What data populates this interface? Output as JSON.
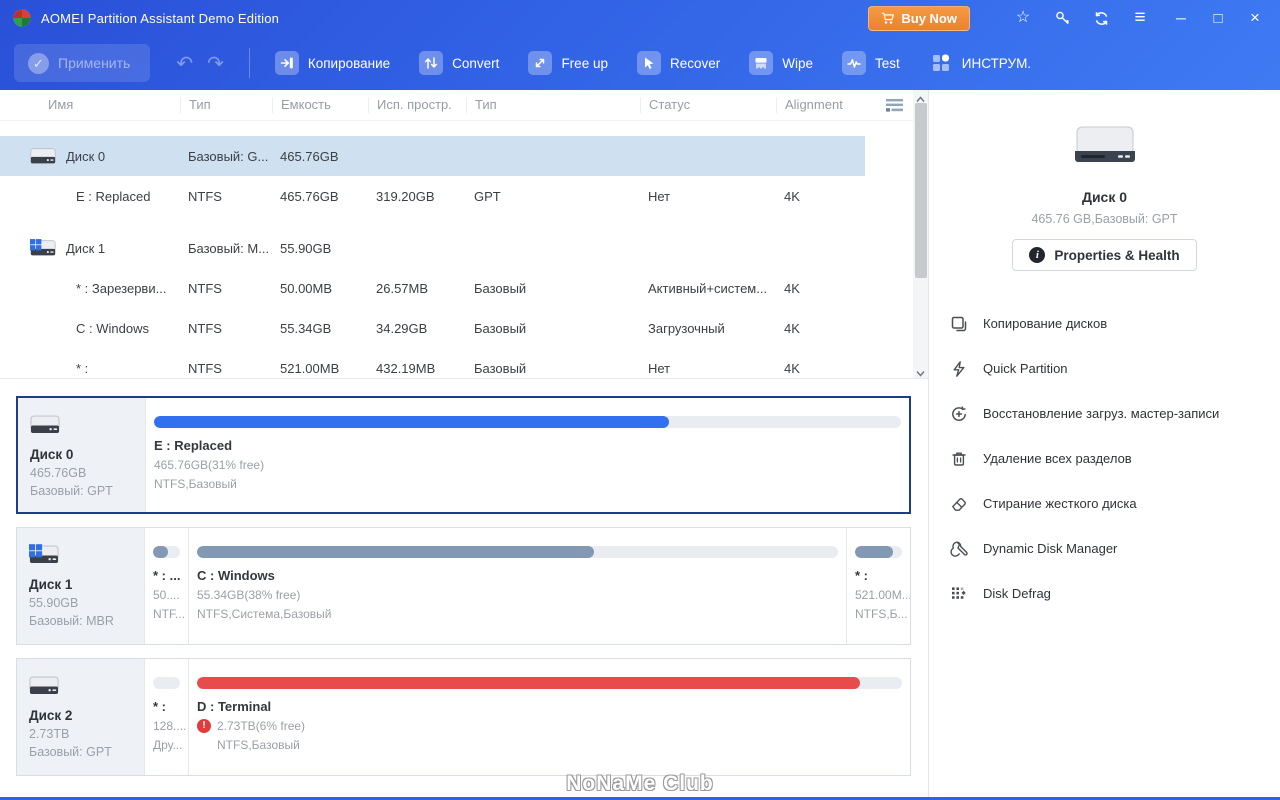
{
  "titlebar": {
    "title": "AOMEI Partition Assistant Demo Edition",
    "buy_now": "Buy Now"
  },
  "toolbar": {
    "apply": "Применить",
    "copy": "Копирование",
    "convert": "Convert",
    "freeup": "Free up",
    "recover": "Recover",
    "wipe": "Wipe",
    "test": "Test",
    "instrum": "ИНСТРУМ."
  },
  "table": {
    "columns": [
      "Имя",
      "Тип",
      "Емкость",
      "Исп. простр.",
      "Тип",
      "Статус",
      "Alignment"
    ],
    "rows": [
      {
        "name": "Диск 0",
        "type": "Базовый: G...",
        "capacity": "465.76GB",
        "used": "",
        "type2": "",
        "status": "",
        "alignment": ""
      },
      {
        "name": "E : Replaced",
        "type": "NTFS",
        "capacity": "465.76GB",
        "used": "319.20GB",
        "type2": "GPT",
        "status": "Нет",
        "alignment": "4K"
      },
      {
        "name": "Диск 1",
        "type": "Базовый: M...",
        "capacity": "55.90GB",
        "used": "",
        "type2": "",
        "status": "",
        "alignment": ""
      },
      {
        "name": "* : Зарезерви...",
        "type": "NTFS",
        "capacity": "50.00MB",
        "used": "26.57MB",
        "type2": "Базовый",
        "status": "Активный+систем...",
        "alignment": "4K"
      },
      {
        "name": "C : Windows",
        "type": "NTFS",
        "capacity": "55.34GB",
        "used": "34.29GB",
        "type2": "Базовый",
        "status": "Загрузочный",
        "alignment": "4K"
      },
      {
        "name": "* :",
        "type": "NTFS",
        "capacity": "521.00MB",
        "used": "432.19MB",
        "type2": "Базовый",
        "status": "Нет",
        "alignment": "4K"
      }
    ]
  },
  "disks": [
    {
      "name": "Диск 0",
      "size": "465.76GB",
      "scheme": "Базовый: GPT",
      "partitions": [
        {
          "title": "E : Replaced",
          "line2": "465.76GB(31% free)",
          "line3": "NTFS,Базовый",
          "fill": 69,
          "color": "#3270ef"
        }
      ]
    },
    {
      "name": "Диск 1",
      "size": "55.90GB",
      "scheme": "Базовый: MBR",
      "partitions": [
        {
          "title": "* : ...",
          "line2": "50....",
          "line3": "NTF...",
          "fill": 55,
          "color": "#8398b3"
        },
        {
          "title": "C : Windows",
          "line2": "55.34GB(38% free)",
          "line3": "NTFS,Система,Базовый",
          "fill": 62,
          "color": "#8398b3"
        },
        {
          "title": "* :",
          "line2": "521.00M...",
          "line3": "NTFS,Б...",
          "fill": 80,
          "color": "#8398b3"
        }
      ]
    },
    {
      "name": "Диск 2",
      "size": "2.73TB",
      "scheme": "Базовый: GPT",
      "partitions": [
        {
          "title": "* :",
          "line2": "128....",
          "line3": "Дру...",
          "fill": 0,
          "color": "#e9edf2"
        },
        {
          "title": "D : Terminal",
          "line2": "2.73TB(6% free)",
          "line3": "NTFS,Базовый",
          "fill": 94,
          "color": "#e84b4b"
        }
      ]
    }
  ],
  "sidebar": {
    "disk_name": "Диск 0",
    "disk_info": "465.76 GB,Базовый: GPT",
    "properties_button": "Properties & Health",
    "menu": [
      {
        "label": "Копирование дисков"
      },
      {
        "label": "Quick Partition"
      },
      {
        "label": "Восстановление загруз. мастер-записи"
      },
      {
        "label": "Удаление всех разделов"
      },
      {
        "label": "Стирание жесткого диска"
      },
      {
        "label": "Dynamic Disk Manager"
      },
      {
        "label": "Disk Defrag"
      }
    ]
  },
  "watermark": "NoNaMe Club",
  "colors": {
    "titlebar_blue": "#2f5fe0",
    "buy_now_orange": "#ef8a36",
    "selected_row": "#cfe1f1",
    "bar_blue": "#3270ef",
    "bar_gray": "#8398b3",
    "bar_red": "#e84b4b",
    "warning_red": "#e23b3b",
    "selected_panel_border": "#1e3c8c"
  }
}
